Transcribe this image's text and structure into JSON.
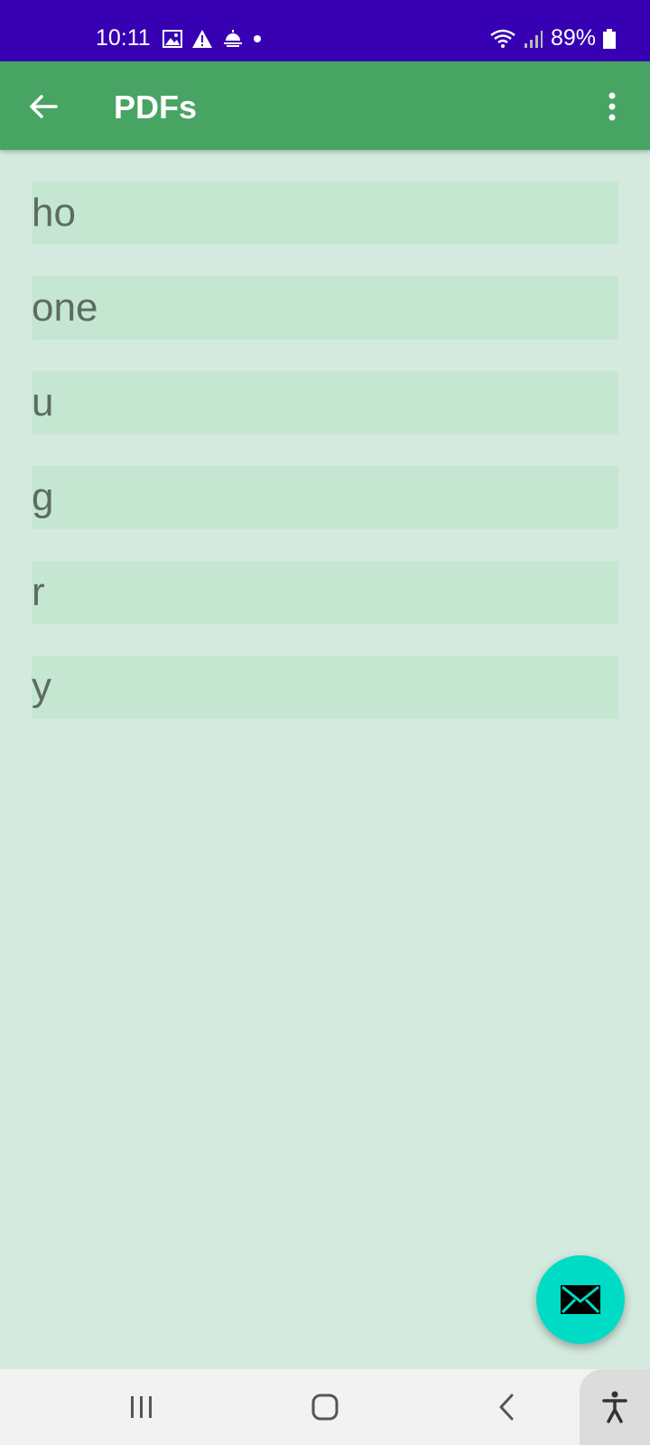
{
  "status_bar": {
    "time": "10:11",
    "battery_percent": "89%",
    "icons_left": [
      "image-icon",
      "warning-icon",
      "weather-icon",
      "dot-icon"
    ],
    "icons_right": [
      "wifi-icon",
      "signal-icon",
      "battery-icon"
    ]
  },
  "app_bar": {
    "title": "PDFs",
    "back_icon": "arrow-left-icon",
    "menu_icon": "more-vert-icon",
    "color": "#48a463"
  },
  "list": {
    "items": [
      "ho",
      "one",
      "u",
      "g",
      "r",
      "y"
    ],
    "item_bg": "#c5e7d2",
    "background": "#d5eade"
  },
  "fab": {
    "icon": "mail-icon",
    "color": "#00dbc6"
  },
  "nav_bar": {
    "buttons": [
      "recent-apps-icon",
      "home-icon",
      "back-icon",
      "accessibility-icon"
    ]
  }
}
